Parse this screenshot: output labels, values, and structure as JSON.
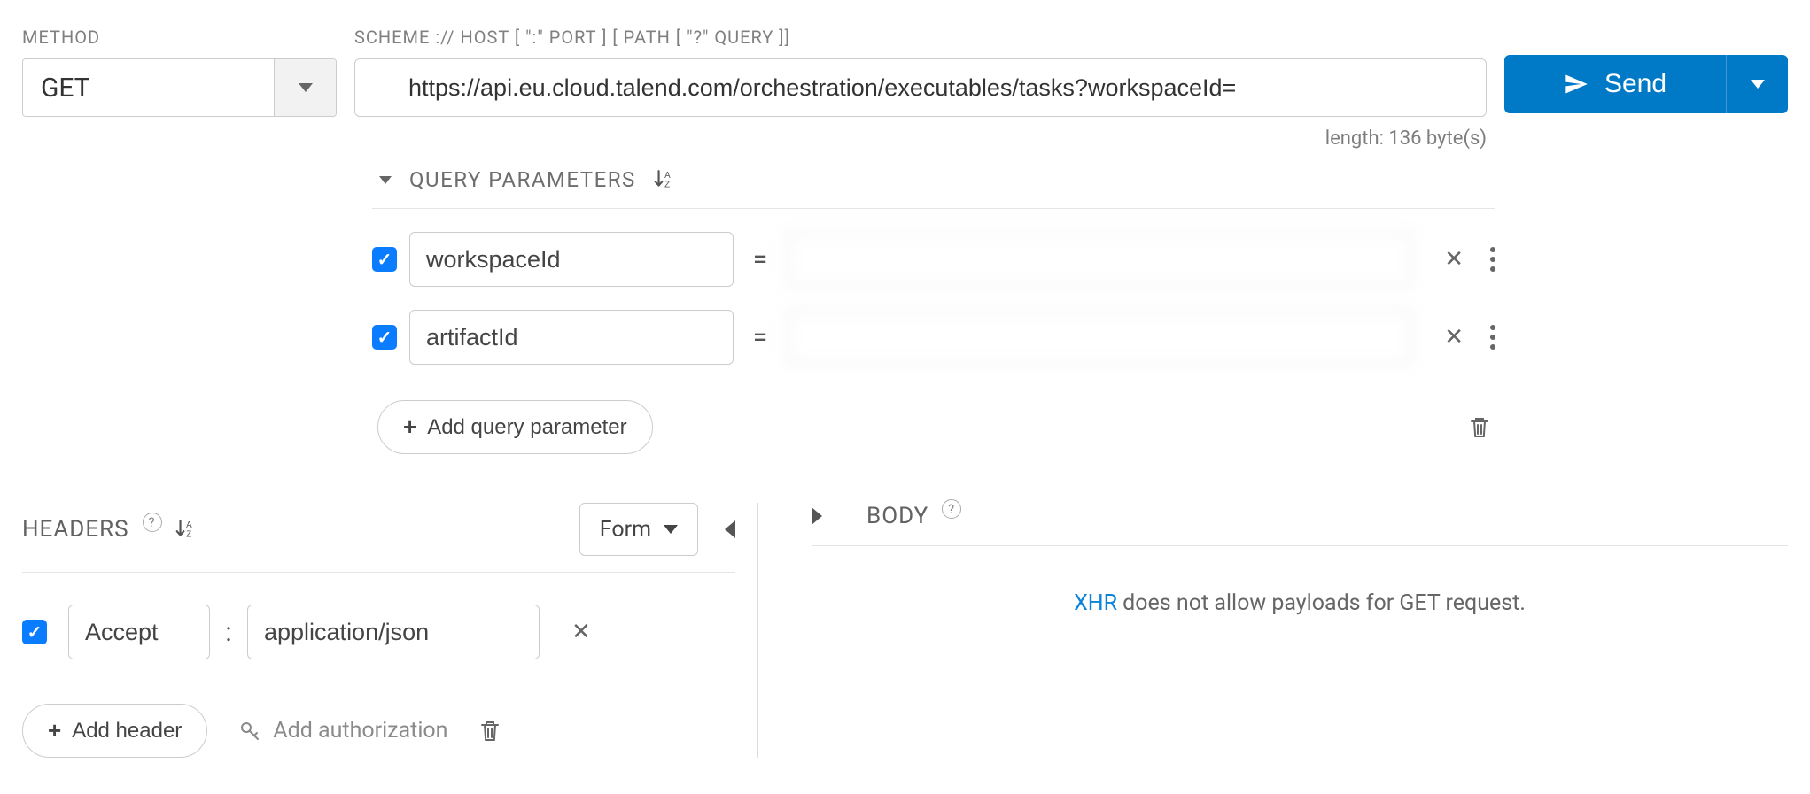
{
  "labels": {
    "method": "METHOD",
    "scheme": "SCHEME :// HOST [ \":\" PORT ] [ PATH [ \"?\" QUERY ]]",
    "headers": "HEADERS",
    "body": "BODY",
    "query_params": "QUERY PARAMETERS"
  },
  "method": {
    "value": "GET"
  },
  "url": {
    "value": "https://api.eu.cloud.talend.com/orchestration/executables/tasks?workspaceId="
  },
  "length_text": "length: 136 byte(s)",
  "send_label": "Send",
  "query_params": [
    {
      "enabled": true,
      "name": "workspaceId",
      "value": ""
    },
    {
      "enabled": true,
      "name": "artifactId",
      "value": ""
    }
  ],
  "add_query_param_label": "Add query parameter",
  "headers_section": {
    "mode": "Form",
    "items": [
      {
        "enabled": true,
        "name": "Accept",
        "value": "application/json"
      }
    ],
    "add_header_label": "Add header",
    "add_auth_label": "Add authorization"
  },
  "body_section": {
    "xhr": "XHR",
    "msg_rest": " does not allow payloads for GET request."
  }
}
